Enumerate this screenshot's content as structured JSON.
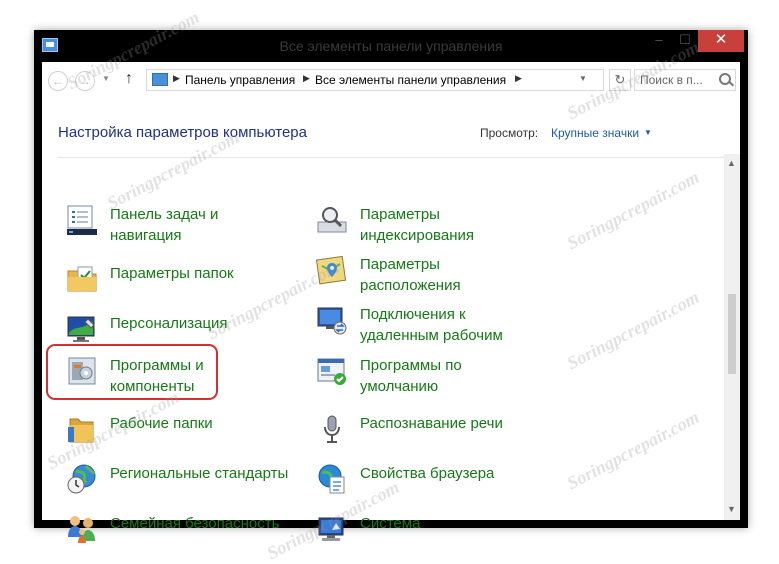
{
  "window": {
    "title": "Все элементы панели управления",
    "controls": {
      "minimize": "‒",
      "maximize": "☐",
      "close": "✕"
    }
  },
  "addressbar": {
    "back": "←",
    "forward": "→",
    "up": "↑",
    "breadcrumb": [
      "Панель управления",
      "Все элементы панели управления"
    ],
    "search_placeholder": "Поиск в п..."
  },
  "header": {
    "title": "Настройка параметров компьютера",
    "view_label": "Просмотр:",
    "view_value": "Крупные значки"
  },
  "items_left": [
    {
      "label": "Панель задач и навигация",
      "icon": "taskbar-icon"
    },
    {
      "label": "Параметры папок",
      "icon": "folder-options-icon"
    },
    {
      "label": "Персонализация",
      "icon": "personalization-icon"
    },
    {
      "label": "Программы и компоненты",
      "icon": "programs-features-icon",
      "highlighted": true
    },
    {
      "label": "Рабочие папки",
      "icon": "work-folders-icon"
    },
    {
      "label": "Региональные стандарты",
      "icon": "region-icon"
    },
    {
      "label": "Семейная безопасность",
      "icon": "family-safety-icon"
    }
  ],
  "items_right": [
    {
      "label": "Параметры индексирования",
      "icon": "indexing-icon"
    },
    {
      "label": "Параметры расположения",
      "icon": "location-icon"
    },
    {
      "label": "Подключения к удаленным рабочим",
      "icon": "remote-connections-icon"
    },
    {
      "label": "Программы по умолчанию",
      "icon": "default-programs-icon"
    },
    {
      "label": "Распознавание речи",
      "icon": "speech-recognition-icon"
    },
    {
      "label": "Свойства браузера",
      "icon": "internet-options-icon"
    },
    {
      "label": "Система",
      "icon": "system-icon"
    }
  ],
  "watermark": "Soringpcrepair.com",
  "colors": {
    "link_green": "#157a15",
    "title_blue": "#1e3287",
    "close_red": "#c7413a",
    "highlight_red": "#d43030"
  }
}
